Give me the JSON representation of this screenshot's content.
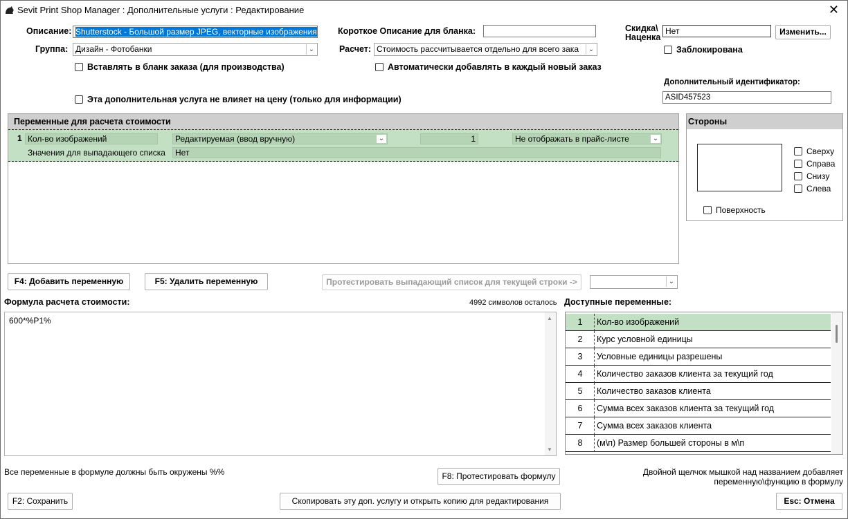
{
  "window": {
    "title": "Sevit Print Shop Manager : Дополнительные услуги : Редактирование",
    "close_glyph": "✕"
  },
  "top": {
    "description_label": "Описание:",
    "description_value": "Shutterstock - Большой размер JPEG, векторные изображения",
    "group_label": "Группа:",
    "group_value": "Дизайн - Фотобанки",
    "short_desc_label": "Короткое Описание для бланка:",
    "short_desc_value": "",
    "calc_label": "Расчет:",
    "calc_value": "Стоимость рассчитывается отдельно для всего зака",
    "discount_label_1": "Скидка\\",
    "discount_label_2": "Наценка",
    "discount_value": "Нет",
    "change_button": "Изменить...",
    "blocked_label": "Заблокирована",
    "insert_blank_label": "Вставлять в бланк заказа (для производства)",
    "auto_add_label": "Автоматически добавлять в каждый новый заказ",
    "no_price_label": "Эта дополнительная услуга не влияет на цену (только для информации)",
    "extra_id_label": "Дополнительный идентификатор:",
    "extra_id_value": "ASID457523"
  },
  "variables": {
    "header": "Переменные для расчета стоимости",
    "rows": [
      {
        "index": "1",
        "name": "Кол-во изображений",
        "type": "Редактируемая (ввод вручную)",
        "value": "1",
        "price_display": "Не отображать в прайс-листе",
        "dropdown_label": "Значения для выпадающего списка",
        "dropdown_value": "Нет"
      }
    ]
  },
  "sides": {
    "header": "Стороны",
    "top": "Сверху",
    "right": "Справа",
    "bottom": "Снизу",
    "left": "Слева",
    "surface": "Поверхность"
  },
  "actions": {
    "add_variable": "F4: Добавить переменную",
    "delete_variable": "F5: Удалить переменную",
    "test_dropdown": "Протестировать выпадающий список для текущей строки ->",
    "test_dropdown_value": ""
  },
  "formula": {
    "label": "Формула расчета стоимости:",
    "chars_left": "4992 символов осталось",
    "text": "600*%P1%",
    "note": "Все переменные в формуле должны быть окружены %%",
    "test_button": "F8: Протестировать формулу"
  },
  "available": {
    "label": "Доступные переменные:",
    "items": [
      {
        "num": "1",
        "name": "Кол-во изображений"
      },
      {
        "num": "2",
        "name": "Курс условной единицы"
      },
      {
        "num": "3",
        "name": "Условные единицы разрешены"
      },
      {
        "num": "4",
        "name": "Количество заказов клиента за текущий год"
      },
      {
        "num": "5",
        "name": "Количество заказов клиента"
      },
      {
        "num": "6",
        "name": "Сумма всех заказов клиента за текущий год"
      },
      {
        "num": "7",
        "name": "Сумма всех заказов клиента"
      },
      {
        "num": "8",
        "name": "(м\\п)  Размер большей стороны в м\\п"
      }
    ],
    "hint_1": "Двойной щелчок мышкой над названием добавляет",
    "hint_2": "переменную\\функцию в формулу"
  },
  "footer": {
    "save": "F2: Сохранить",
    "copy": "Скопировать эту доп. услугу и открыть копию для редактирования",
    "cancel": "Esc: Отмена"
  },
  "colors": {
    "selection": "#0078d7",
    "grid_green": "#c4e0c4",
    "header_gray": "#cfcfcf"
  }
}
